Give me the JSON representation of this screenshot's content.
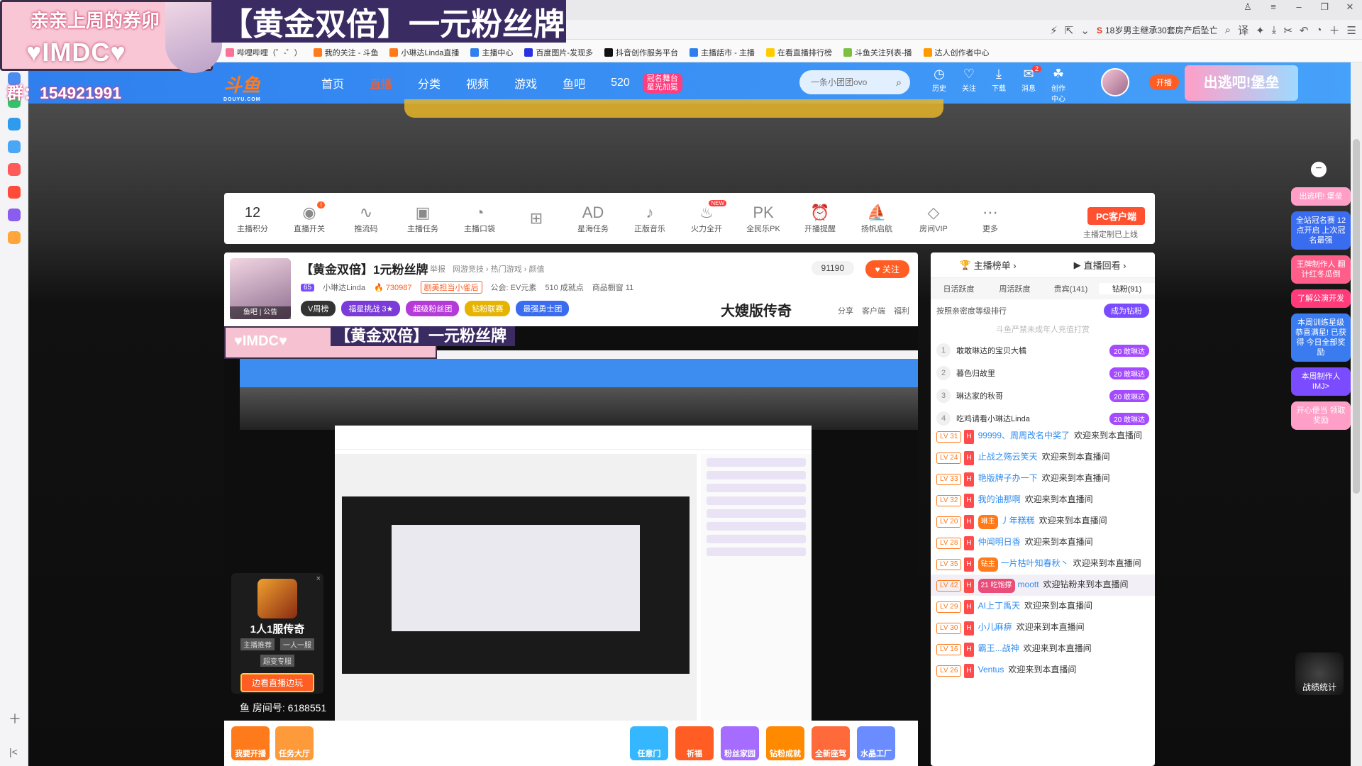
{
  "overlay": {
    "line1": "亲亲上周的券卯",
    "line2": "♥IMDC♥",
    "banner": "【黄金双倍】一元粉丝牌",
    "qq_group": "群：154921991"
  },
  "browser": {
    "hot_search": "18岁男主继承30套房产后坠亡",
    "bookmarks": [
      {
        "label": "哔哩哔哩（゜-゜）",
        "color": "#fb7299"
      },
      {
        "label": "我的关注 - 斗鱼",
        "color": "#ff7a1a"
      },
      {
        "label": "小琳达Linda直播",
        "color": "#ff7a1a"
      },
      {
        "label": "主播中心",
        "color": "#2f80ee"
      },
      {
        "label": "百度图片-发现多",
        "color": "#2932e1"
      },
      {
        "label": "抖音创作服务平台",
        "color": "#111111"
      },
      {
        "label": "主播話市 - 主播",
        "color": "#2f80ee"
      },
      {
        "label": "在看直播排行榜",
        "color": "#ffcc00"
      },
      {
        "label": "斗鱼关注列表-播",
        "color": "#7bc043"
      },
      {
        "label": "达人创作者中心",
        "color": "#ff9900"
      }
    ]
  },
  "header": {
    "logo": "斗鱼",
    "logo_sub": "DOUYU.COM",
    "nav": [
      "首页",
      "直播",
      "分类",
      "视频",
      "游戏",
      "鱼吧",
      "520"
    ],
    "nav_active": "直播",
    "promo_line1": "冠名舞台",
    "promo_line2": "星光加冕",
    "search_placeholder": "一条小团团ovo",
    "user_items": [
      "历史",
      "关注",
      "下载",
      "消息",
      "创作中心"
    ],
    "message_badge": "2",
    "open_label": "开播",
    "escape_banner": "出逃吧!堡垒"
  },
  "toolbar": {
    "points_value": "12",
    "items": [
      {
        "label": "主播积分",
        "icon": "points-icon"
      },
      {
        "label": "直播开关",
        "icon": "toggle-icon"
      },
      {
        "label": "推流码",
        "icon": "waveform-icon"
      },
      {
        "label": "主播任务",
        "icon": "task-icon"
      },
      {
        "label": "主播口袋",
        "icon": "pocket-icon"
      },
      {
        "label": "",
        "icon": "gift-icon"
      },
      {
        "label": "星海任务",
        "icon": "ad-icon"
      },
      {
        "label": "正版音乐",
        "icon": "music-icon"
      },
      {
        "label": "火力全开",
        "icon": "fire-icon"
      },
      {
        "label": "全民乐PK",
        "icon": "pk-icon"
      },
      {
        "label": "开播提醒",
        "icon": "alarm-icon"
      },
      {
        "label": "扬帆启航",
        "icon": "sail-icon"
      },
      {
        "label": "房间VIP",
        "icon": "vip-icon"
      },
      {
        "label": "更多",
        "icon": "more-icon"
      }
    ],
    "toggle_dot": "!",
    "fire_new": "NEW",
    "pc_client": "PC客户端",
    "pc_sub": "主播定制已上线"
  },
  "room": {
    "title": "【黄金双倍】1元粉丝牌",
    "links": [
      "举报",
      "网游竞技 › 热门游戏 › 颜值"
    ],
    "level": "65",
    "streamer": "小琳达Linda",
    "hot": "730987",
    "badge": "剧美担当小雀后",
    "notice": "公会: EV元素",
    "fans": "510 成就点",
    "gift_count": "商品橱窗 11",
    "avatar_tag": "鱼吧 | 公告",
    "pills": [
      {
        "label": "V周榜",
        "color": "#333333"
      },
      {
        "label": "福星挑战 3★",
        "color": "#7a3bd8"
      },
      {
        "label": "超级粉丝团",
        "color": "#b53bd8"
      },
      {
        "label": "钻粉联赛",
        "color": "#e6b400"
      },
      {
        "label": "最强勇士团",
        "color": "#3a6cf0"
      }
    ],
    "legend": "大嫂版传奇",
    "follow_count": "91190",
    "follow_label": "关注",
    "actions": [
      "分享",
      "客户端",
      "福利"
    ]
  },
  "video": {
    "overlay_text": "♥IMDC♥",
    "title_text": "【黄金双倍】一元粉丝牌",
    "room_number": "鱼 房间号: 6188551",
    "game_ad": {
      "name": "1人1服传奇",
      "tags": [
        "主播推荐",
        "一人一服",
        "超变专服"
      ],
      "button": "边看直播边玩",
      "close": "×"
    }
  },
  "gift_bar": {
    "left": [
      {
        "label": "我要开播",
        "color": "#ff7a1a"
      },
      {
        "label": "任务大厅",
        "color": "#ff9a3a"
      }
    ],
    "right": [
      {
        "label": "任意门",
        "color": "#35b7ff"
      },
      {
        "label": "祈福",
        "color": "#ff5d23"
      },
      {
        "label": "粉丝家园",
        "color": "#a66bff"
      },
      {
        "label": "钻粉成就",
        "color": "#ff8a00"
      },
      {
        "label": "全新座驾",
        "color": "#ff6a3a"
      },
      {
        "label": "水晶工厂",
        "color": "#6a8cff"
      }
    ]
  },
  "rank": {
    "head": [
      "主播榜单",
      "直播回看"
    ],
    "tabs": [
      "日活跃度",
      "周活跃度",
      "贵宾(141)",
      "钻粉(91)"
    ],
    "active_tab": "钻粉(91)",
    "sort_label": "按照亲密度等级排行",
    "become_btn": "成为钻粉",
    "note": "斗鱼严禁未成年人充值打赏",
    "rows": [
      {
        "n": "1",
        "name": "敢敢琳达的宝贝大橘",
        "badge": "20 敢琳达"
      },
      {
        "n": "2",
        "name": "暮色归故里",
        "badge": "20 敢琳达"
      },
      {
        "n": "3",
        "name": "琳达家的秋哥",
        "badge": "20 敢琳达"
      },
      {
        "n": "4",
        "name": "吃鸡请看小琳达Linda",
        "badge": "20 敢琳达"
      }
    ]
  },
  "chat": [
    {
      "lv": "LV 31",
      "user": "99999、周周改名中奖了",
      "msg": "欢迎来到本直播间"
    },
    {
      "lv": "LV 24",
      "user": "止战之殇云笑天",
      "msg": "欢迎来到本直播间"
    },
    {
      "lv": "LV 33",
      "user": "艳版牌子办一下",
      "msg": "欢迎来到本直播间"
    },
    {
      "lv": "LV 32",
      "user": "我的油那啊",
      "msg": "欢迎来到本直播间"
    },
    {
      "lv": "LV 20",
      "user": "丿年糕糕",
      "fan": "琳主",
      "msg": "欢迎来到本直播间"
    },
    {
      "lv": "LV 28",
      "user": "仲闻明日香",
      "msg": "欢迎来到本直播间"
    },
    {
      "lv": "LV 35",
      "user": "一片枯叶知春秋丶",
      "fan": "钻主",
      "msg": "欢迎来到本直播间"
    },
    {
      "lv": "LV 42",
      "user": "moott",
      "fan2": "21 吃饱撑",
      "msg": "欢迎钻粉来到本直播间",
      "hl": true
    },
    {
      "lv": "LV 29",
      "user": "AI上丁禹天",
      "msg": "欢迎来到本直播间"
    },
    {
      "lv": "LV 30",
      "user": "小儿麻痹",
      "msg": "欢迎来到本直播间"
    },
    {
      "lv": "LV 16",
      "user": "霸王...战神",
      "msg": "欢迎来到本直播间"
    },
    {
      "lv": "LV 26",
      "user": "Ventus",
      "msg": "欢迎来到本直播间"
    }
  ],
  "promos": [
    {
      "text": "出逃吧! 堡垒",
      "color": "#ff9ec7"
    },
    {
      "text": "全站冠名赛 12点开启 上次冠名最强",
      "color": "#3a6cf0"
    },
    {
      "text": "王牌制作人 翻计红冬瓜倒",
      "color": "#ff5d8a"
    },
    {
      "text": "了解公演开发",
      "color": "#ff3b7a"
    },
    {
      "text": "本周训练星级 恭喜满星! 已获得 今日全部奖励",
      "color": "#3a7cf0"
    },
    {
      "text": "本周制作人 IMJ>",
      "color": "#7a4bff"
    },
    {
      "text": "开心便当 领取奖励",
      "color": "#ff9ec7"
    }
  ],
  "battle": "战绩统计"
}
